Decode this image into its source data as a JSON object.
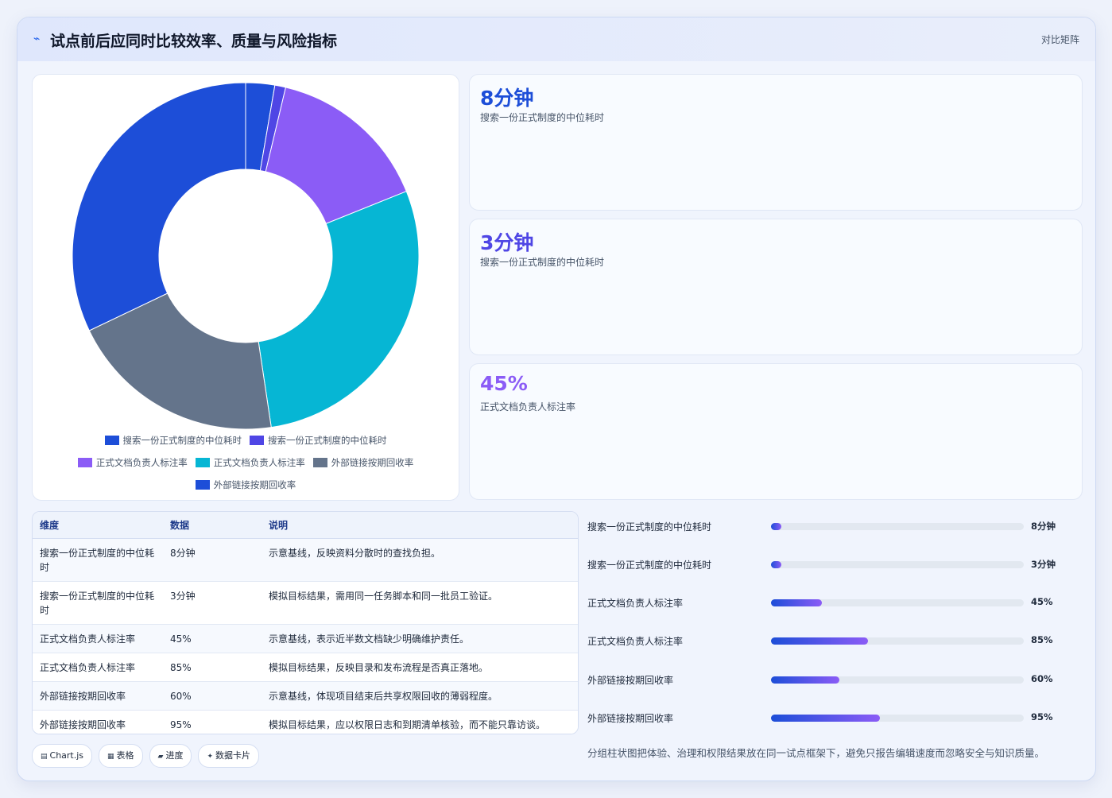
{
  "header": {
    "icon": "chart-icon",
    "title": "试点前后应同时比较效率、质量与风险指标",
    "tag": "对比矩阵"
  },
  "chart_data": {
    "type": "pie",
    "donut": true,
    "categories": [
      "搜索一份正式制度的中位耗时",
      "搜索一份正式制度的中位耗时",
      "正式文档负责人标注率",
      "正式文档负责人标注率",
      "外部链接按期回收率",
      "外部链接按期回收率"
    ],
    "values": [
      8,
      3,
      45,
      85,
      60,
      95
    ],
    "colors": [
      "#1d4ed8",
      "#4f46e5",
      "#8b5cf6",
      "#06b6d4",
      "#64748b",
      "#1d4ed8"
    ],
    "legend": "bottom"
  },
  "stats": [
    {
      "value": "8分钟",
      "label": "搜索一份正式制度的中位耗时",
      "color": "#1d4ed8"
    },
    {
      "value": "3分钟",
      "label": "搜索一份正式制度的中位耗时",
      "color": "#4f46e5"
    },
    {
      "value": "45%",
      "label": "正式文档负责人标注率",
      "color": "#8b5cf6"
    }
  ],
  "table": {
    "headers": [
      "维度",
      "数据",
      "说明"
    ],
    "rows": [
      {
        "dim": "搜索一份正式制度的中位耗时",
        "data": "8分钟",
        "desc": "示意基线，反映资料分散时的查找负担。"
      },
      {
        "dim": "搜索一份正式制度的中位耗时",
        "data": "3分钟",
        "desc": "模拟目标结果，需用同一任务脚本和同一批员工验证。"
      },
      {
        "dim": "正式文档负责人标注率",
        "data": "45%",
        "desc": "示意基线，表示近半数文档缺少明确维护责任。"
      },
      {
        "dim": "正式文档负责人标注率",
        "data": "85%",
        "desc": "模拟目标结果，反映目录和发布流程是否真正落地。"
      },
      {
        "dim": "外部链接按期回收率",
        "data": "60%",
        "desc": "示意基线，体现项目结束后共享权限回收的薄弱程度。"
      },
      {
        "dim": "外部链接按期回收率",
        "data": "95%",
        "desc": "模拟目标结果，应以权限日志和到期清单核验，而不能只靠访谈。"
      }
    ]
  },
  "progress": [
    {
      "label": "搜索一份正式制度的中位耗时",
      "value": "8分钟",
      "fraction": 0.04
    },
    {
      "label": "搜索一份正式制度的中位耗时",
      "value": "3分钟",
      "fraction": 0.04
    },
    {
      "label": "正式文档负责人标注率",
      "value": "45%",
      "fraction": 0.2
    },
    {
      "label": "正式文档负责人标注率",
      "value": "85%",
      "fraction": 0.385
    },
    {
      "label": "外部链接按期回收率",
      "value": "60%",
      "fraction": 0.27
    },
    {
      "label": "外部链接按期回收率",
      "value": "95%",
      "fraction": 0.43
    }
  ],
  "chips": [
    {
      "icon": "chart-icon",
      "glyph": "▤",
      "label": "Chart.js"
    },
    {
      "icon": "table-icon",
      "glyph": "▦",
      "label": "表格"
    },
    {
      "icon": "progress-icon",
      "glyph": "▰",
      "label": "进度"
    },
    {
      "icon": "card-icon",
      "glyph": "✦",
      "label": "数据卡片"
    }
  ],
  "note": "分组柱状图把体验、治理和权限结果放在同一试点框架下，避免只报告编辑速度而忽略安全与知识质量。"
}
